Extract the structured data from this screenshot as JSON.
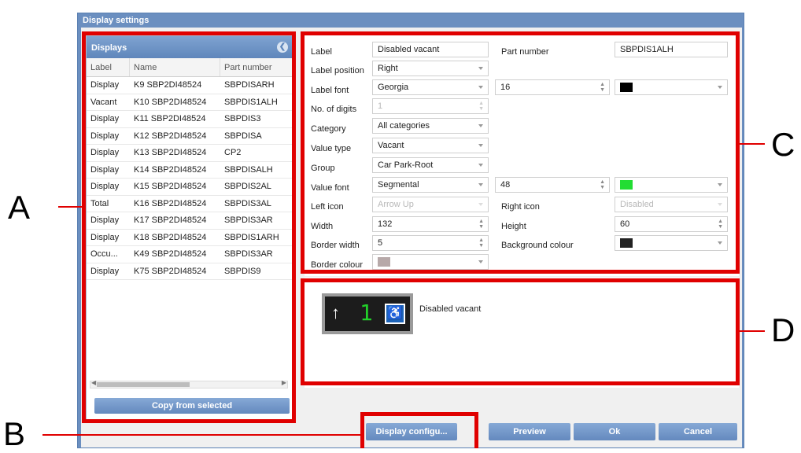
{
  "dialog": {
    "title": "Display settings"
  },
  "displays": {
    "title": "Displays",
    "columns": [
      "Label",
      "Name",
      "Part number"
    ],
    "rows": [
      [
        "Display",
        "K9 SBP2DI48524",
        "SBPDISARH"
      ],
      [
        "Vacant",
        "K10 SBP2DI48524",
        "SBPDIS1ALH"
      ],
      [
        "Display",
        "K11 SBP2DI48524",
        "SBPDIS3"
      ],
      [
        "Display",
        "K12 SBP2DI48524",
        "SBPDISA"
      ],
      [
        "Display",
        "K13 SBP2DI48524",
        "CP2"
      ],
      [
        "Display",
        "K14 SBP2DI48524",
        "SBPDISALH"
      ],
      [
        "Display",
        "K15 SBP2DI48524",
        "SBPDIS2AL"
      ],
      [
        "Total",
        "K16 SBP2DI48524",
        "SBPDIS3AL"
      ],
      [
        "Display",
        "K17 SBP2DI48524",
        "SBPDIS3AR"
      ],
      [
        "Display",
        "K18 SBP2DI48524",
        "SBPDIS1ARH"
      ],
      [
        "Occu...",
        "K49 SBP2DI48524",
        "SBPDIS3AR"
      ],
      [
        "Display",
        "K75 SBP2DI48524",
        "SBPDIS9"
      ]
    ],
    "copy_button": "Copy from selected"
  },
  "form": {
    "label_label": "Label",
    "label_value": "Disabled vacant",
    "part_number_label": "Part number",
    "part_number_value": "SBPDIS1ALH",
    "label_position_label": "Label position",
    "label_position_value": "Right",
    "label_font_label": "Label font",
    "label_font_value": "Georgia",
    "label_font_size": "16",
    "label_font_color": "#000000",
    "digits_label": "No. of digits",
    "digits_value": "1",
    "category_label": "Category",
    "category_value": "All categories",
    "value_type_label": "Value type",
    "value_type_value": "Vacant",
    "group_label": "Group",
    "group_value": "Car Park-Root",
    "value_font_label": "Value font",
    "value_font_value": "Segmental",
    "value_font_size": "48",
    "value_font_color": "#22dd33",
    "left_icon_label": "Left icon",
    "left_icon_value": "Arrow Up",
    "right_icon_label": "Right icon",
    "right_icon_value": "Disabled",
    "width_label": "Width",
    "width_value": "132",
    "height_label": "Height",
    "height_value": "60",
    "border_width_label": "Border width",
    "border_width_value": "5",
    "background_colour_label": "Background colour",
    "background_colour_value": "#222222",
    "border_colour_label": "Border colour",
    "border_colour_value": "#b7a9a9"
  },
  "preview": {
    "digit": "1",
    "label": "Disabled vacant"
  },
  "buttons": {
    "display_config": "Display configu...",
    "preview": "Preview",
    "ok": "Ok",
    "cancel": "Cancel"
  },
  "callouts": {
    "a": "A",
    "b": "B",
    "c": "C",
    "d": "D"
  }
}
